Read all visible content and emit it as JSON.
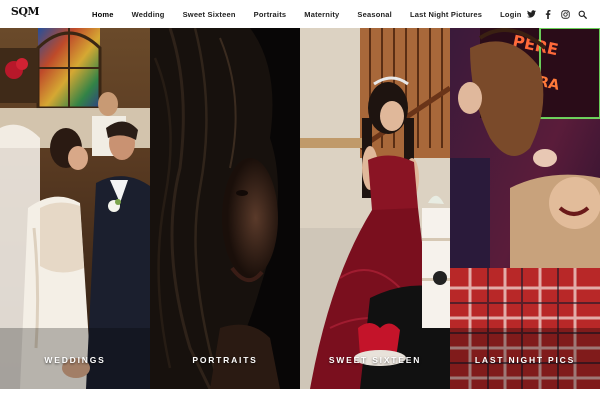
{
  "brand": {
    "logo_text": "SQM"
  },
  "nav": {
    "items": [
      {
        "label": "Home"
      },
      {
        "label": "Wedding"
      },
      {
        "label": "Sweet Sixteen"
      },
      {
        "label": "Portraits"
      },
      {
        "label": "Maternity"
      },
      {
        "label": "Seasonal"
      },
      {
        "label": "Last Night Pictures"
      },
      {
        "label": "Login"
      }
    ],
    "active_index": 0
  },
  "social": {
    "icons": [
      "twitter-icon",
      "facebook-icon",
      "instagram-icon",
      "search-icon"
    ]
  },
  "panels": [
    {
      "label": "WEDDINGS"
    },
    {
      "label": "PORTRAITS"
    },
    {
      "label": "SWEET SIXTEEN"
    },
    {
      "label": "LAST NIGHT PICS"
    }
  ],
  "colors": {
    "header_bg": "#ffffff",
    "nav_text": "#222222",
    "panel_label": "#ffffff"
  }
}
